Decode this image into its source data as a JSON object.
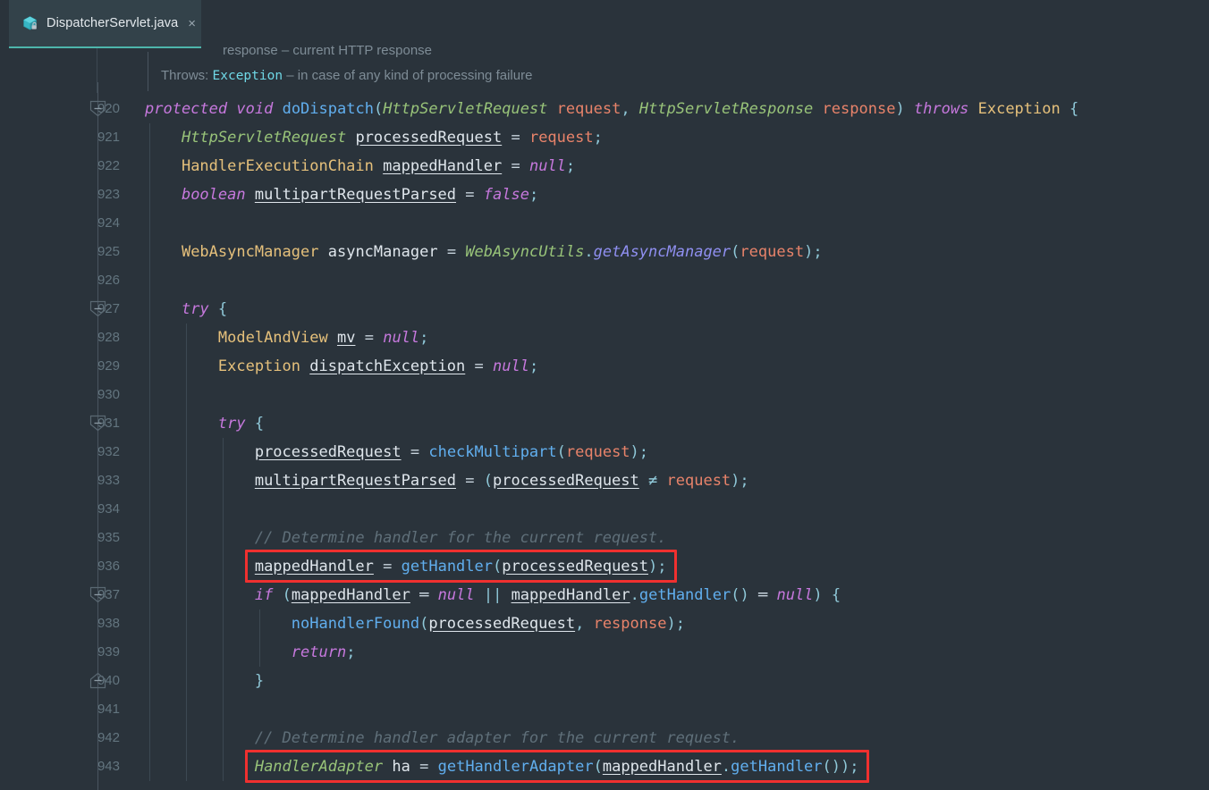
{
  "window": {
    "background": "#2a333b",
    "tabbar_background": "#3c4550"
  },
  "tab": {
    "label": "DispatcherServlet.java",
    "close_label": "×",
    "icon": "java-class-icon",
    "active_underline_color": "#4db6ac",
    "active_background": "#33424a"
  },
  "javadoc": {
    "line1": "response – current HTTP response",
    "line2_label": "Throws:",
    "line2_type": "Exception",
    "line2_text": "– in case of any kind of processing failure"
  },
  "gutter": {
    "line_numbers": [
      920,
      921,
      922,
      923,
      924,
      925,
      926,
      927,
      928,
      929,
      930,
      931,
      932,
      933,
      934,
      935,
      936,
      937,
      938,
      939,
      940,
      941,
      942,
      943
    ],
    "fold_markers": [
      {
        "line": 920,
        "direction": "down"
      },
      {
        "line": 927,
        "direction": "down"
      },
      {
        "line": 931,
        "direction": "down"
      },
      {
        "line": 937,
        "direction": "down"
      },
      {
        "line": 940,
        "direction": "up"
      }
    ]
  },
  "annotations": {
    "color": "#f0302f",
    "boxes": [
      {
        "name": "highlight-line-936",
        "target_line": 936,
        "label": "mappedHandler = getHandler(processedRequest);"
      },
      {
        "name": "highlight-line-943",
        "target_line": 943,
        "label": "HandlerAdapter ha = getHandlerAdapter(mappedHandler.getHandler());"
      }
    ]
  },
  "code": {
    "language": "Java",
    "lines": [
      {
        "n": 920,
        "text": "protected void doDispatch(HttpServletRequest request, HttpServletResponse response) throws Exception {"
      },
      {
        "n": 921,
        "text": "    HttpServletRequest processedRequest = request;"
      },
      {
        "n": 922,
        "text": "    HandlerExecutionChain mappedHandler = null;"
      },
      {
        "n": 923,
        "text": "    boolean multipartRequestParsed = false;"
      },
      {
        "n": 924,
        "text": ""
      },
      {
        "n": 925,
        "text": "    WebAsyncManager asyncManager = WebAsyncUtils.getAsyncManager(request);"
      },
      {
        "n": 926,
        "text": ""
      },
      {
        "n": 927,
        "text": "    try {"
      },
      {
        "n": 928,
        "text": "        ModelAndView mv = null;"
      },
      {
        "n": 929,
        "text": "        Exception dispatchException = null;"
      },
      {
        "n": 930,
        "text": ""
      },
      {
        "n": 931,
        "text": "        try {"
      },
      {
        "n": 932,
        "text": "            processedRequest = checkMultipart(request);"
      },
      {
        "n": 933,
        "text": "            multipartRequestParsed = (processedRequest != request);"
      },
      {
        "n": 934,
        "text": ""
      },
      {
        "n": 935,
        "text": "            // Determine handler for the current request."
      },
      {
        "n": 936,
        "text": "            mappedHandler = getHandler(processedRequest);"
      },
      {
        "n": 937,
        "text": "            if (mappedHandler == null || mappedHandler.getHandler() == null) {"
      },
      {
        "n": 938,
        "text": "                noHandlerFound(processedRequest, response);"
      },
      {
        "n": 939,
        "text": "                return;"
      },
      {
        "n": 940,
        "text": "            }"
      },
      {
        "n": 941,
        "text": ""
      },
      {
        "n": 942,
        "text": "            // Determine handler adapter for the current request."
      },
      {
        "n": 943,
        "text": "            HandlerAdapter ha = getHandlerAdapter(mappedHandler.getHandler());"
      }
    ],
    "tokens": [
      {
        "n": 920,
        "parts": [
          {
            "t": "protected",
            "c": "kw"
          },
          {
            "t": " ",
            "c": "plain"
          },
          {
            "t": "void",
            "c": "kw"
          },
          {
            "t": " ",
            "c": "plain"
          },
          {
            "t": "doDispatch",
            "c": "mth"
          },
          {
            "t": "(",
            "c": "punc"
          },
          {
            "t": "HttpServletRequest",
            "c": "iface"
          },
          {
            "t": " ",
            "c": "plain"
          },
          {
            "t": "request",
            "c": "param"
          },
          {
            "t": ",",
            "c": "punc"
          },
          {
            "t": " ",
            "c": "plain"
          },
          {
            "t": "HttpServletResponse",
            "c": "iface"
          },
          {
            "t": " ",
            "c": "plain"
          },
          {
            "t": "response",
            "c": "param"
          },
          {
            "t": ")",
            "c": "punc"
          },
          {
            "t": " ",
            "c": "plain"
          },
          {
            "t": "throws",
            "c": "kw"
          },
          {
            "t": " ",
            "c": "plain"
          },
          {
            "t": "Exception",
            "c": "cls"
          },
          {
            "t": " ",
            "c": "plain"
          },
          {
            "t": "{",
            "c": "punc"
          }
        ]
      },
      {
        "n": 921,
        "parts": [
          {
            "t": "    ",
            "c": "plain"
          },
          {
            "t": "HttpServletRequest",
            "c": "iface"
          },
          {
            "t": " ",
            "c": "plain"
          },
          {
            "t": "processedRequest",
            "c": "lvar"
          },
          {
            "t": " ",
            "c": "plain"
          },
          {
            "t": "=",
            "c": "op"
          },
          {
            "t": " ",
            "c": "plain"
          },
          {
            "t": "request",
            "c": "param"
          },
          {
            "t": ";",
            "c": "punc"
          }
        ]
      },
      {
        "n": 922,
        "parts": [
          {
            "t": "    ",
            "c": "plain"
          },
          {
            "t": "HandlerExecutionChain",
            "c": "cls"
          },
          {
            "t": " ",
            "c": "plain"
          },
          {
            "t": "mappedHandler",
            "c": "lvar"
          },
          {
            "t": " ",
            "c": "plain"
          },
          {
            "t": "=",
            "c": "op"
          },
          {
            "t": " ",
            "c": "plain"
          },
          {
            "t": "null",
            "c": "kwn"
          },
          {
            "t": ";",
            "c": "punc"
          }
        ]
      },
      {
        "n": 923,
        "parts": [
          {
            "t": "    ",
            "c": "plain"
          },
          {
            "t": "boolean",
            "c": "kw"
          },
          {
            "t": " ",
            "c": "plain"
          },
          {
            "t": "multipartRequestParsed",
            "c": "lvar"
          },
          {
            "t": " ",
            "c": "plain"
          },
          {
            "t": "=",
            "c": "op"
          },
          {
            "t": " ",
            "c": "plain"
          },
          {
            "t": "false",
            "c": "kwn"
          },
          {
            "t": ";",
            "c": "punc"
          }
        ]
      },
      {
        "n": 924,
        "parts": []
      },
      {
        "n": 925,
        "parts": [
          {
            "t": "    ",
            "c": "plain"
          },
          {
            "t": "WebAsyncManager",
            "c": "cls"
          },
          {
            "t": " ",
            "c": "plain"
          },
          {
            "t": "asyncManager",
            "c": "fld"
          },
          {
            "t": " ",
            "c": "plain"
          },
          {
            "t": "=",
            "c": "op"
          },
          {
            "t": " ",
            "c": "plain"
          },
          {
            "t": "WebAsyncUtils",
            "c": "iface"
          },
          {
            "t": ".",
            "c": "punc"
          },
          {
            "t": "getAsyncManager",
            "c": "smth"
          },
          {
            "t": "(",
            "c": "punc"
          },
          {
            "t": "request",
            "c": "param"
          },
          {
            "t": ")",
            "c": "punc"
          },
          {
            "t": ";",
            "c": "punc"
          }
        ]
      },
      {
        "n": 926,
        "parts": []
      },
      {
        "n": 927,
        "parts": [
          {
            "t": "    ",
            "c": "plain"
          },
          {
            "t": "try",
            "c": "kw"
          },
          {
            "t": " ",
            "c": "plain"
          },
          {
            "t": "{",
            "c": "punc"
          }
        ]
      },
      {
        "n": 928,
        "parts": [
          {
            "t": "        ",
            "c": "plain"
          },
          {
            "t": "ModelAndView",
            "c": "cls"
          },
          {
            "t": " ",
            "c": "plain"
          },
          {
            "t": "mv",
            "c": "lvar"
          },
          {
            "t": " ",
            "c": "plain"
          },
          {
            "t": "=",
            "c": "op"
          },
          {
            "t": " ",
            "c": "plain"
          },
          {
            "t": "null",
            "c": "kwn"
          },
          {
            "t": ";",
            "c": "punc"
          }
        ]
      },
      {
        "n": 929,
        "parts": [
          {
            "t": "        ",
            "c": "plain"
          },
          {
            "t": "Exception",
            "c": "cls"
          },
          {
            "t": " ",
            "c": "plain"
          },
          {
            "t": "dispatchException",
            "c": "lvar"
          },
          {
            "t": " ",
            "c": "plain"
          },
          {
            "t": "=",
            "c": "op"
          },
          {
            "t": " ",
            "c": "plain"
          },
          {
            "t": "null",
            "c": "kwn"
          },
          {
            "t": ";",
            "c": "punc"
          }
        ]
      },
      {
        "n": 930,
        "parts": []
      },
      {
        "n": 931,
        "parts": [
          {
            "t": "        ",
            "c": "plain"
          },
          {
            "t": "try",
            "c": "kw"
          },
          {
            "t": " ",
            "c": "plain"
          },
          {
            "t": "{",
            "c": "punc"
          }
        ]
      },
      {
        "n": 932,
        "parts": [
          {
            "t": "            ",
            "c": "plain"
          },
          {
            "t": "processedRequest",
            "c": "lvar"
          },
          {
            "t": " ",
            "c": "plain"
          },
          {
            "t": "=",
            "c": "op"
          },
          {
            "t": " ",
            "c": "plain"
          },
          {
            "t": "checkMultipart",
            "c": "mth"
          },
          {
            "t": "(",
            "c": "punc"
          },
          {
            "t": "request",
            "c": "param"
          },
          {
            "t": ")",
            "c": "punc"
          },
          {
            "t": ";",
            "c": "punc"
          }
        ]
      },
      {
        "n": 933,
        "parts": [
          {
            "t": "            ",
            "c": "plain"
          },
          {
            "t": "multipartRequestParsed",
            "c": "lvar"
          },
          {
            "t": " ",
            "c": "plain"
          },
          {
            "t": "=",
            "c": "op"
          },
          {
            "t": " ",
            "c": "plain"
          },
          {
            "t": "(",
            "c": "punc"
          },
          {
            "t": "processedRequest",
            "c": "lvar"
          },
          {
            "t": " ",
            "c": "plain"
          },
          {
            "t": "≠",
            "c": "punc"
          },
          {
            "t": " ",
            "c": "plain"
          },
          {
            "t": "request",
            "c": "param"
          },
          {
            "t": ")",
            "c": "punc"
          },
          {
            "t": ";",
            "c": "punc"
          }
        ]
      },
      {
        "n": 934,
        "parts": []
      },
      {
        "n": 935,
        "parts": [
          {
            "t": "            ",
            "c": "plain"
          },
          {
            "t": "// Determine handler for the current request.",
            "c": "cmt"
          }
        ]
      },
      {
        "n": 936,
        "parts": [
          {
            "t": "            ",
            "c": "plain"
          },
          {
            "t": "mappedHandler",
            "c": "lvar"
          },
          {
            "t": " ",
            "c": "plain"
          },
          {
            "t": "=",
            "c": "op"
          },
          {
            "t": " ",
            "c": "plain"
          },
          {
            "t": "getHandler",
            "c": "mth"
          },
          {
            "t": "(",
            "c": "punc"
          },
          {
            "t": "processedRequest",
            "c": "lvar"
          },
          {
            "t": ")",
            "c": "punc"
          },
          {
            "t": ";",
            "c": "punc"
          }
        ]
      },
      {
        "n": 937,
        "parts": [
          {
            "t": "            ",
            "c": "plain"
          },
          {
            "t": "if",
            "c": "kw"
          },
          {
            "t": " ",
            "c": "plain"
          },
          {
            "t": "(",
            "c": "punc"
          },
          {
            "t": "mappedHandler",
            "c": "lvar"
          },
          {
            "t": " ",
            "c": "plain"
          },
          {
            "t": "═",
            "c": "op"
          },
          {
            "t": " ",
            "c": "plain"
          },
          {
            "t": "null",
            "c": "kwn"
          },
          {
            "t": " ",
            "c": "plain"
          },
          {
            "t": "||",
            "c": "punc"
          },
          {
            "t": " ",
            "c": "plain"
          },
          {
            "t": "mappedHandler",
            "c": "lvar"
          },
          {
            "t": ".",
            "c": "punc"
          },
          {
            "t": "getHandler",
            "c": "mth"
          },
          {
            "t": "()",
            "c": "punc"
          },
          {
            "t": " ",
            "c": "plain"
          },
          {
            "t": "═",
            "c": "op"
          },
          {
            "t": " ",
            "c": "plain"
          },
          {
            "t": "null",
            "c": "kwn"
          },
          {
            "t": ")",
            "c": "punc"
          },
          {
            "t": " ",
            "c": "plain"
          },
          {
            "t": "{",
            "c": "punc"
          }
        ]
      },
      {
        "n": 938,
        "parts": [
          {
            "t": "                ",
            "c": "plain"
          },
          {
            "t": "noHandlerFound",
            "c": "mth"
          },
          {
            "t": "(",
            "c": "punc"
          },
          {
            "t": "processedRequest",
            "c": "lvar"
          },
          {
            "t": ",",
            "c": "punc"
          },
          {
            "t": " ",
            "c": "plain"
          },
          {
            "t": "response",
            "c": "param"
          },
          {
            "t": ")",
            "c": "punc"
          },
          {
            "t": ";",
            "c": "punc"
          }
        ]
      },
      {
        "n": 939,
        "parts": [
          {
            "t": "                ",
            "c": "plain"
          },
          {
            "t": "return",
            "c": "kw"
          },
          {
            "t": ";",
            "c": "punc"
          }
        ]
      },
      {
        "n": 940,
        "parts": [
          {
            "t": "            ",
            "c": "plain"
          },
          {
            "t": "}",
            "c": "punc"
          }
        ]
      },
      {
        "n": 941,
        "parts": []
      },
      {
        "n": 942,
        "parts": [
          {
            "t": "            ",
            "c": "plain"
          },
          {
            "t": "// Determine handler adapter for the current request.",
            "c": "cmt"
          }
        ]
      },
      {
        "n": 943,
        "parts": [
          {
            "t": "            ",
            "c": "plain"
          },
          {
            "t": "HandlerAdapter",
            "c": "iface"
          },
          {
            "t": " ",
            "c": "plain"
          },
          {
            "t": "ha",
            "c": "fld"
          },
          {
            "t": " ",
            "c": "plain"
          },
          {
            "t": "=",
            "c": "op"
          },
          {
            "t": " ",
            "c": "plain"
          },
          {
            "t": "getHandlerAdapter",
            "c": "mth"
          },
          {
            "t": "(",
            "c": "punc"
          },
          {
            "t": "mappedHandler",
            "c": "lvar"
          },
          {
            "t": ".",
            "c": "punc"
          },
          {
            "t": "getHandler",
            "c": "mth"
          },
          {
            "t": "()",
            "c": "punc"
          },
          {
            "t": ")",
            "c": "punc"
          },
          {
            "t": ";",
            "c": "punc"
          }
        ]
      }
    ]
  }
}
